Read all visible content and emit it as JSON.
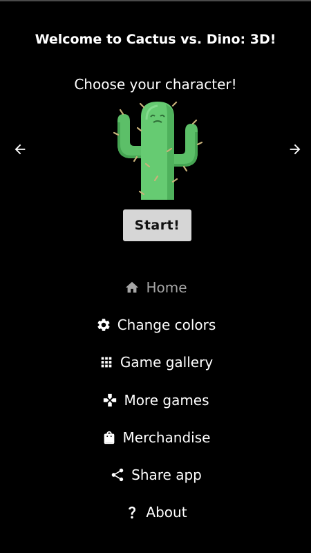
{
  "header": {
    "title": "Welcome to Cactus vs. Dino: 3D!",
    "subtitle": "Choose your character!"
  },
  "character_picker": {
    "selected_character_icon": "cactus-icon",
    "prev_icon": "arrow-left-icon",
    "next_icon": "arrow-right-icon"
  },
  "start_button": {
    "label": "Start!"
  },
  "menu": {
    "items": [
      {
        "label": "Home",
        "icon": "home-icon",
        "active": true
      },
      {
        "label": "Change colors",
        "icon": "gear-icon",
        "active": false
      },
      {
        "label": "Game gallery",
        "icon": "grid-icon",
        "active": false
      },
      {
        "label": "More games",
        "icon": "gamepad-icon",
        "active": false
      },
      {
        "label": "Merchandise",
        "icon": "shopping-bag-icon",
        "active": false
      },
      {
        "label": "Share app",
        "icon": "share-icon",
        "active": false
      },
      {
        "label": "About",
        "icon": "question-icon",
        "active": false
      }
    ]
  },
  "colors": {
    "background": "#000000",
    "text": "#ffffff",
    "active_menu_text": "#a6a6a6",
    "button_background": "#d6d6d6",
    "cactus_green": "#5fc36b"
  }
}
